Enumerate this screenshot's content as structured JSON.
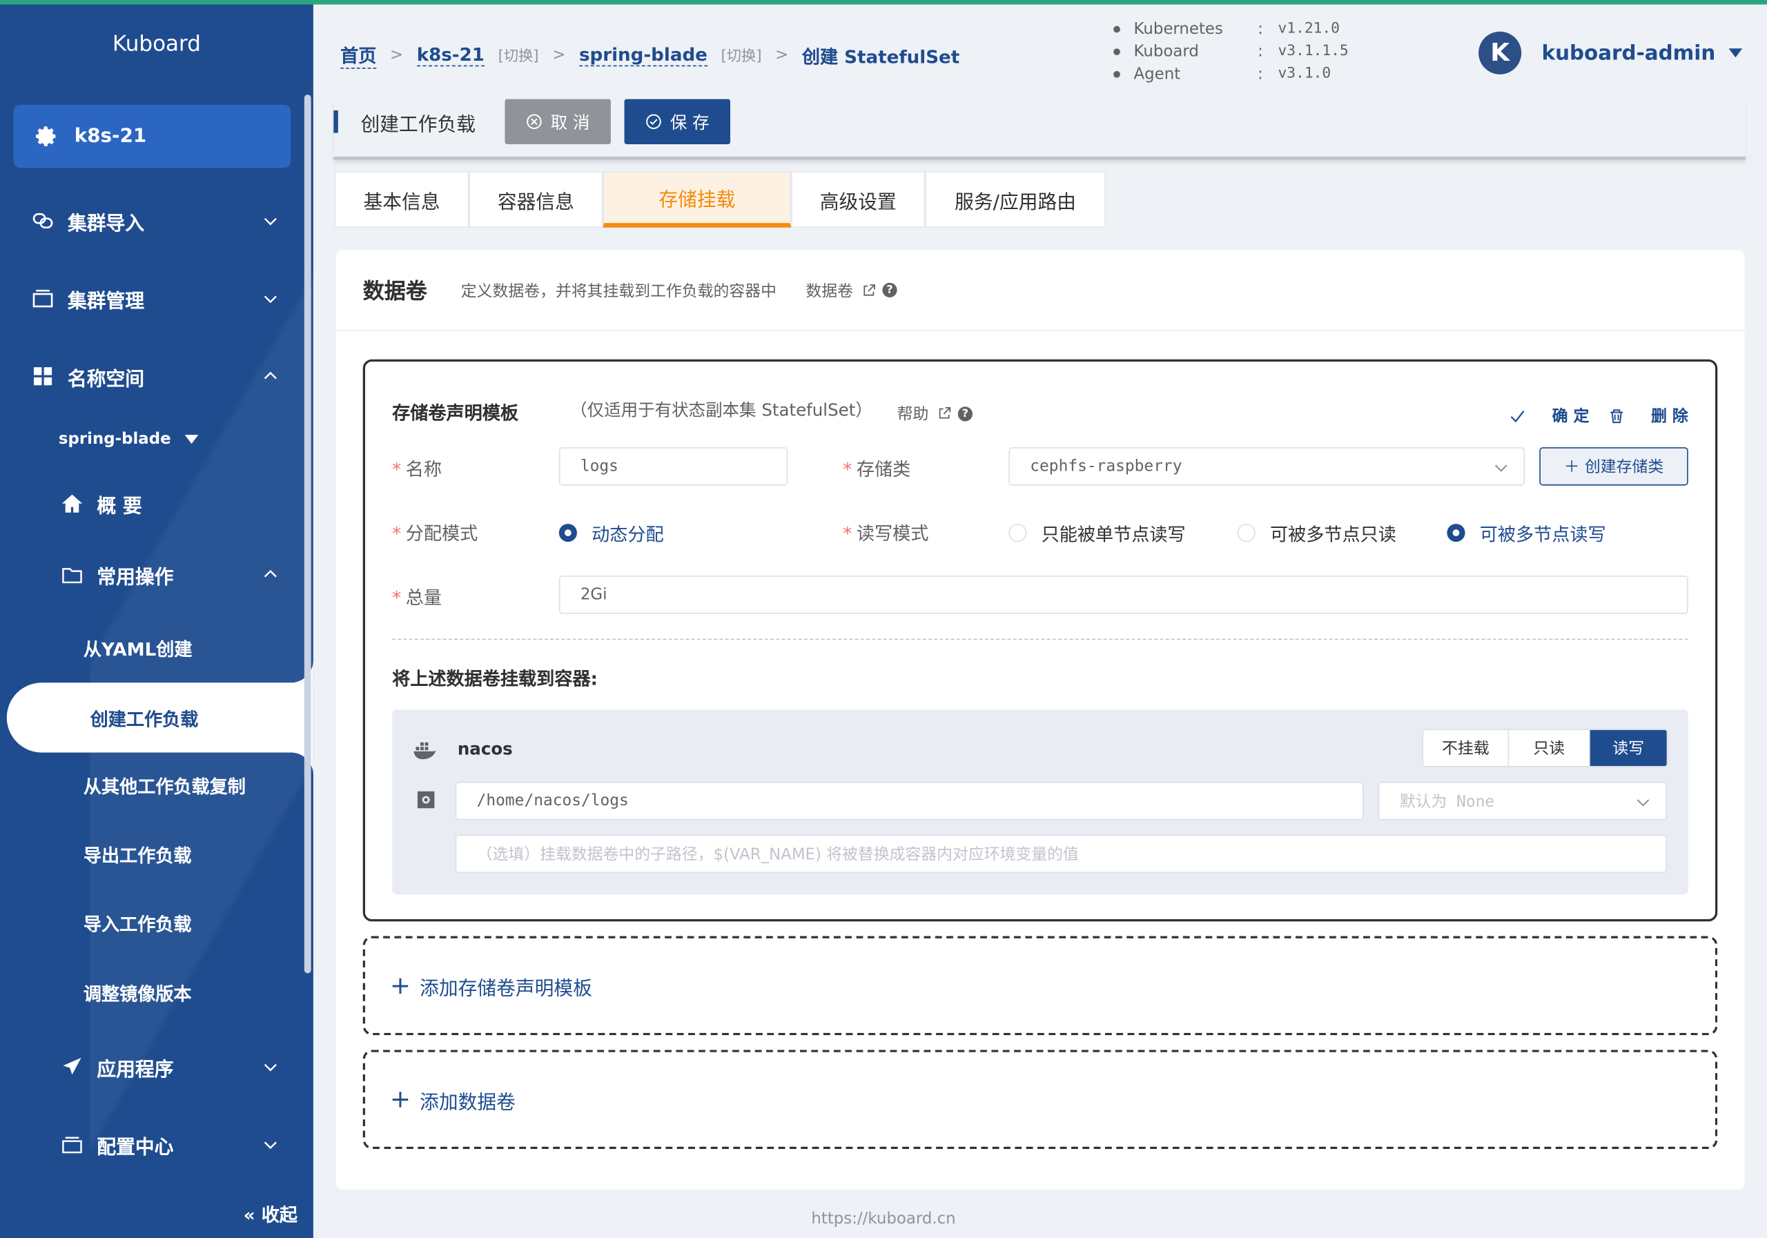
{
  "sidebar": {
    "brand": "Kuboard",
    "cluster": "k8s-21",
    "menu": {
      "cluster_import": "集群导入",
      "cluster_manage": "集群管理",
      "namespace": "名称空间",
      "namespace_selected": "spring-blade",
      "overview": "概 要",
      "common_ops": "常用操作",
      "from_yaml": "从YAML创建",
      "create_workload": "创建工作负载",
      "copy_workload": "从其他工作负载复制",
      "export_workload": "导出工作负载",
      "import_workload": "导入工作负载",
      "adjust_image": "调整镜像版本",
      "applications": "应用程序",
      "config_center": "配置中心"
    },
    "collapse": "收起"
  },
  "breadcrumb": {
    "home": "首页",
    "cluster": "k8s-21",
    "cluster_switch": "[切换]",
    "namespace": "spring-blade",
    "namespace_switch": "[切换]",
    "current": "创建 StatefulSet"
  },
  "versions": [
    {
      "name": "Kubernetes",
      "value": "v1.21.0"
    },
    {
      "name": "Kuboard",
      "value": "v3.1.1.5"
    },
    {
      "name": "Agent",
      "value": "v3.1.0"
    }
  ],
  "user": {
    "initial": "K",
    "name": "kuboard-admin"
  },
  "toolbar": {
    "title": "创建工作负载",
    "cancel": "取 消",
    "save": "保 存"
  },
  "tabs": [
    "基本信息",
    "容器信息",
    "存储挂载",
    "高级设置",
    "服务/应用路由"
  ],
  "active_tab": "存储挂载",
  "volumes": {
    "title": "数据卷",
    "description": "定义数据卷，并将其挂载到工作负载的容器中",
    "help": "数据卷"
  },
  "pvc_template": {
    "title": "存储卷声明模板",
    "note": "（仅适用于有状态副本集 StatefulSet）",
    "help": "帮助",
    "confirm": "确 定",
    "delete": "删 除",
    "name_label": "名称",
    "name_value": "logs",
    "storage_class_label": "存储类",
    "storage_class_value": "cephfs-raspberry",
    "create_storage_class": "创建存储类",
    "provision_label": "分配模式",
    "provision_value": "动态分配",
    "access_label": "读写模式",
    "access_options": [
      "只能被单节点读写",
      "可被多节点只读",
      "可被多节点读写"
    ],
    "access_selected": "可被多节点读写",
    "size_label": "总量",
    "size_value": "2Gi",
    "mount_title": "将上述数据卷挂载到容器:",
    "container": {
      "name": "nacos",
      "modes": [
        "不挂载",
        "只读",
        "读写"
      ],
      "mode_selected": "读写",
      "mount_path": "/home/nacos/logs",
      "propagation_placeholder": "默认为 None",
      "subpath_placeholder": "（选填）挂载数据卷中的子路径，$(VAR_NAME) 将被替换成容器内对应环境变量的值"
    }
  },
  "add_pvc_template": "添加存储卷声明模板",
  "add_volume": "添加数据卷",
  "footer": "https://kuboard.cn",
  "colors": {
    "primary": "#1f4c8f",
    "sidebar": "#1f4c8f",
    "active_tab": "#f58a0c",
    "top_line": "#2aa57f"
  }
}
